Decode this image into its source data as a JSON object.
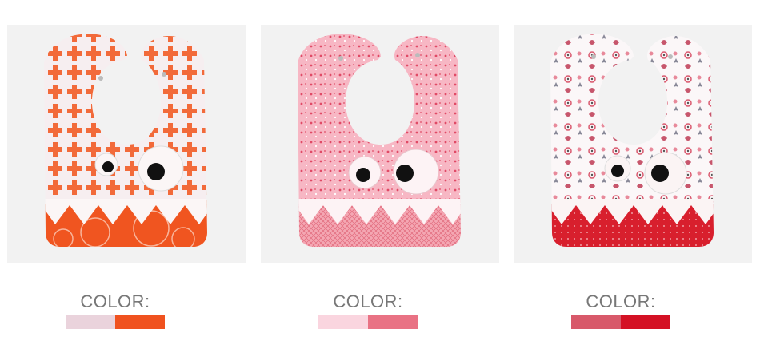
{
  "products": [
    {
      "color_label": "COLOR:",
      "pattern": "orange-crosses",
      "swatches": [
        "#ead3dc",
        "#f0521f"
      ]
    },
    {
      "color_label": "COLOR:",
      "pattern": "pink-dots",
      "swatches": [
        "#fad5df",
        "#e97284"
      ]
    },
    {
      "color_label": "COLOR:",
      "pattern": "floral",
      "swatches": [
        "#d8596a",
        "#d41124"
      ]
    }
  ]
}
